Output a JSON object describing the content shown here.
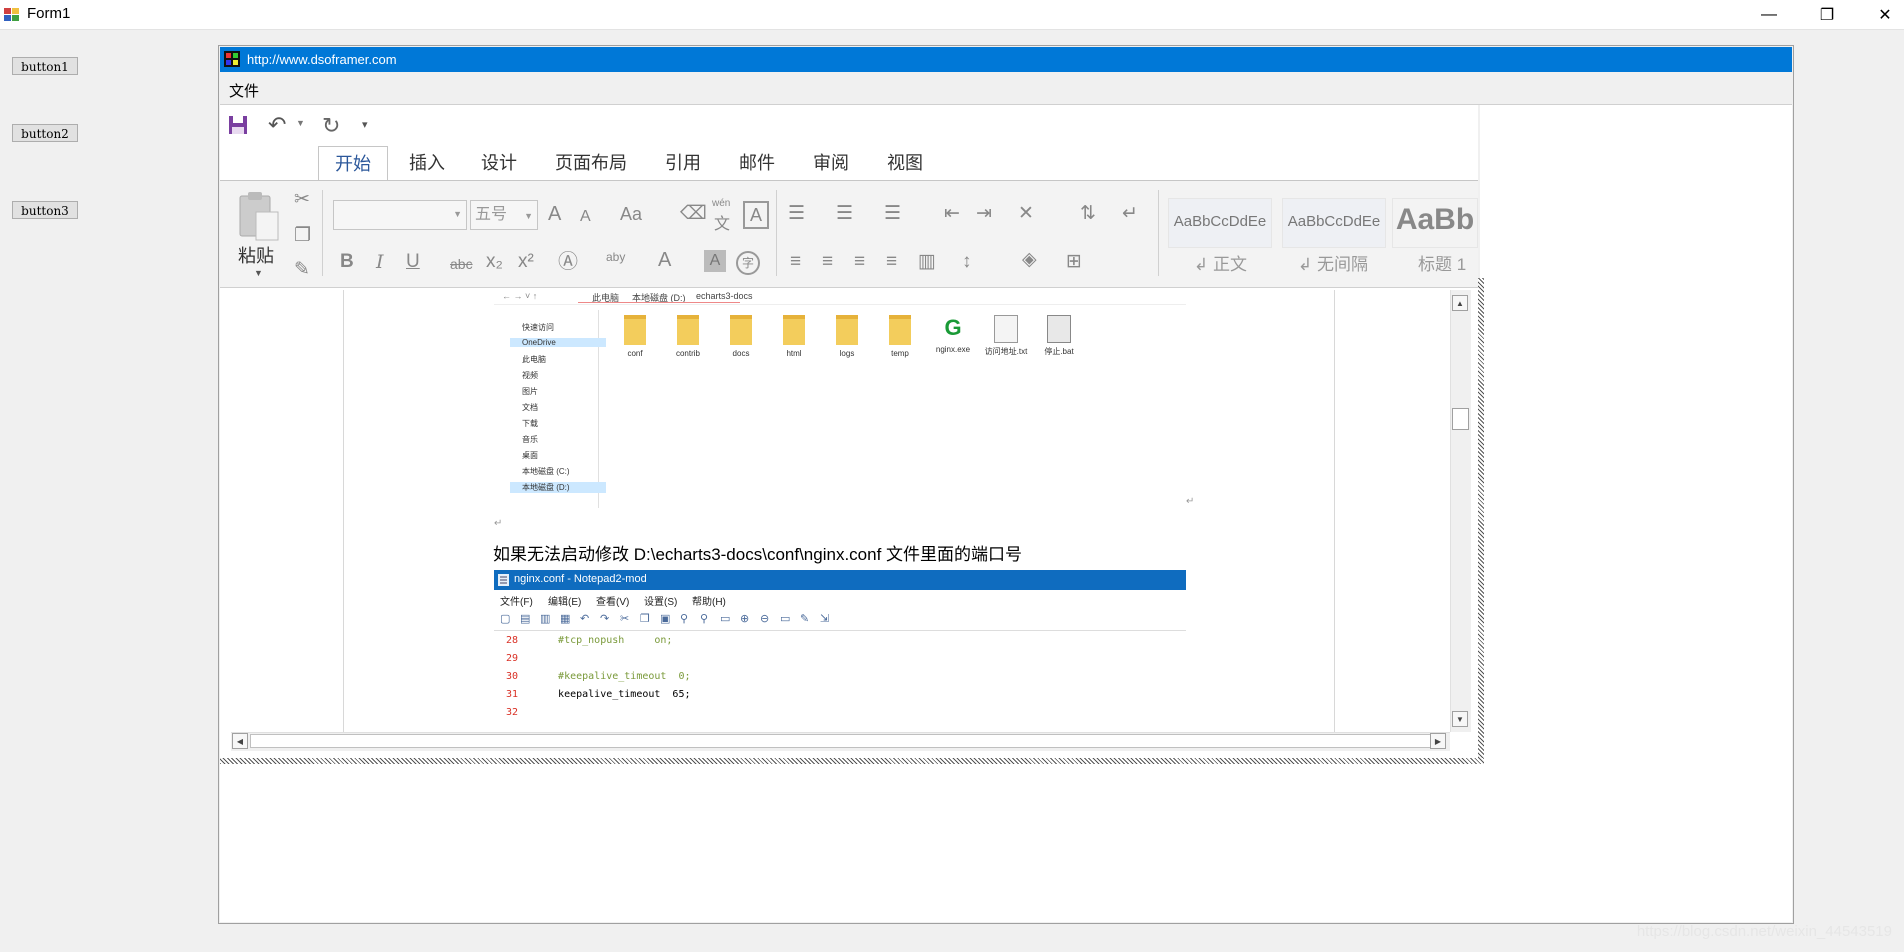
{
  "window": {
    "title": "Form1",
    "minimize_glyph": "—",
    "restore_glyph": "❐",
    "close_glyph": "✕"
  },
  "form_buttons": [
    "button1",
    "button2",
    "button3"
  ],
  "dsoframer": {
    "title_url": "http://www.dsoframer.com",
    "menu_file": "文件"
  },
  "word": {
    "tabs": [
      "开始",
      "插入",
      "设计",
      "页面布局",
      "引用",
      "邮件",
      "审阅",
      "视图"
    ],
    "paste_label": "粘贴",
    "font_size": "五号",
    "styles": [
      {
        "sample": "AaBbCcDdEe",
        "label": "↲ 正文"
      },
      {
        "sample": "AaBbCcDdEe",
        "label": "↲ 无间隔"
      },
      {
        "sample": "AaBb",
        "label": "标题 1"
      }
    ],
    "ribbon_glyphs": {
      "bold": "B",
      "italic": "I",
      "underline": "U",
      "strike": "abc",
      "sub": "x₂",
      "sup": "x²",
      "grow": "A",
      "shrink": "A",
      "case": "Aa",
      "pinyin_top": "wén",
      "pinyin_bottom": "文",
      "border_char": "A",
      "font_color": "A",
      "highlight": "aby",
      "char_shade": "A",
      "enclose": "字"
    }
  },
  "document": {
    "explorer": {
      "breadcrumb": [
        "此电脑",
        "本地磁盘 (D:)",
        "echarts3-docs"
      ],
      "nav_items": [
        {
          "label": "快速访问",
          "selected": false
        },
        {
          "label": "OneDrive",
          "selected": true
        },
        {
          "label": "此电脑",
          "selected": false
        },
        {
          "label": "视频",
          "selected": false
        },
        {
          "label": "图片",
          "selected": false
        },
        {
          "label": "文档",
          "selected": false
        },
        {
          "label": "下载",
          "selected": false
        },
        {
          "label": "音乐",
          "selected": false
        },
        {
          "label": "桌面",
          "selected": false
        },
        {
          "label": "本地磁盘 (C:)",
          "selected": false
        },
        {
          "label": "本地磁盘 (D:)",
          "selected": true
        }
      ],
      "files": [
        {
          "name": "conf",
          "icon": "folder-icon"
        },
        {
          "name": "contrib",
          "icon": "folder-icon"
        },
        {
          "name": "docs",
          "icon": "folder-icon"
        },
        {
          "name": "html",
          "icon": "folder-icon"
        },
        {
          "name": "logs",
          "icon": "folder-icon"
        },
        {
          "name": "temp",
          "icon": "folder-icon"
        },
        {
          "name": "nginx.exe",
          "icon": "nginx-icon"
        },
        {
          "name": "访问地址.txt",
          "icon": "text-file-icon"
        },
        {
          "name": "停止.bat",
          "icon": "bat-file-icon"
        }
      ]
    },
    "paragraph": "如果无法启动修改 D:\\echarts3-docs\\conf\\nginx.conf 文件里面的端口号",
    "notepad": {
      "title": "nginx.conf - Notepad2-mod",
      "menu": [
        "文件(F)",
        "编辑(E)",
        "查看(V)",
        "设置(S)",
        "帮助(H)"
      ],
      "lines": [
        {
          "num": "28",
          "code": "#tcp_nopush     on;",
          "kind": "comment"
        },
        {
          "num": "29",
          "code": "",
          "kind": "plain"
        },
        {
          "num": "30",
          "code": "#keepalive_timeout  0;",
          "kind": "comment"
        },
        {
          "num": "31",
          "code": "keepalive_timeout  65;",
          "kind": "plain"
        },
        {
          "num": "32",
          "code": "",
          "kind": "plain"
        }
      ]
    }
  },
  "watermark": "https://blog.csdn.net/weixin_44543519"
}
